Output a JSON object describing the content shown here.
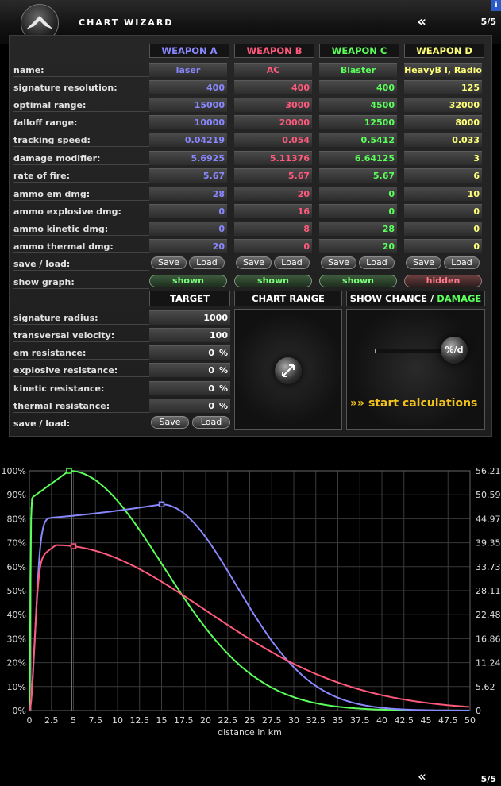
{
  "header": {
    "title": "CHART WIZARD",
    "back_glyph": "«",
    "page": "5/5",
    "corner_badge": "i"
  },
  "weapons": {
    "row_labels": [
      "name:",
      "signature resolution:",
      "optimal range:",
      "falloff range:",
      "tracking speed:",
      "damage modifier:",
      "rate of fire:",
      "ammo em dmg:",
      "ammo explosive dmg:",
      "ammo kinetic dmg:",
      "ammo thermal dmg:",
      "save / load:",
      "show graph:"
    ],
    "columns": [
      {
        "header": "WEAPON A",
        "color": "#8a88ff",
        "values": [
          "laser",
          "400",
          "15000",
          "10000",
          "0.04219",
          "5.6925",
          "5.67",
          "28",
          "0",
          "0",
          "20"
        ],
        "graph": "shown"
      },
      {
        "header": "WEAPON B",
        "color": "#ff5a7c",
        "values": [
          "AC",
          "400",
          "3000",
          "20000",
          "0.054",
          "5.11376",
          "5.67",
          "20",
          "16",
          "8",
          "0"
        ],
        "graph": "shown"
      },
      {
        "header": "WEAPON C",
        "color": "#5aff5a",
        "values": [
          "Blaster",
          "400",
          "4500",
          "12500",
          "0.5412",
          "6.64125",
          "5.67",
          "0",
          "0",
          "28",
          "20"
        ],
        "graph": "shown"
      },
      {
        "header": "WEAPON D",
        "color": "#ffff7a",
        "values": [
          "HeavyB I, Radio",
          "125",
          "32000",
          "8000",
          "0.033",
          "3",
          "6",
          "10",
          "0",
          "0",
          "0"
        ],
        "graph": "hidden"
      }
    ],
    "save_label": "Save",
    "load_label": "Load"
  },
  "target": {
    "headers": {
      "target": "TARGET",
      "chart_range": "CHART RANGE",
      "show_chance": "SHOW CHANCE /",
      "damage": "DAMAGE"
    },
    "row_labels": [
      "signature radius:",
      "transversal velocity:",
      "em resistance:",
      "explosive resistance:",
      "kinetic resistance:",
      "thermal resistance:",
      "save / load:"
    ],
    "values": [
      "1000",
      "100",
      "0",
      "0",
      "0",
      "0"
    ],
    "pct": "%",
    "save_label": "Save",
    "load_label": "Load",
    "toggle_glyph": "%/d",
    "start_label": "start calculations",
    "start_glyph": "»»"
  },
  "chart_data": {
    "type": "line",
    "xlabel": "distance in km",
    "xlim": [
      0,
      50
    ],
    "x_ticks": [
      "0",
      "2.5",
      "5",
      "7.5",
      "10",
      "12.5",
      "15",
      "17.5",
      "20",
      "22.5",
      "25",
      "27.5",
      "30",
      "32.5",
      "35",
      "37.5",
      "40",
      "42.5",
      "45",
      "47.5",
      "50"
    ],
    "y_left_ticks": [
      "0%",
      "10%",
      "20%",
      "30%",
      "40%",
      "50%",
      "60%",
      "70%",
      "80%",
      "90%",
      "100%"
    ],
    "y_right_ticks": [
      "0",
      "5.62",
      "11.24",
      "16.86",
      "22.48",
      "28.11",
      "33.73",
      "39.35",
      "44.97",
      "50.59",
      "56.21"
    ],
    "ylim": [
      0,
      100
    ],
    "grid": true,
    "series": [
      {
        "color": "#5aff5a",
        "optimal_km": 4.5,
        "falloff_km": 12.5,
        "peak": 100,
        "rise": 0.13,
        "marker_x": 4.5
      },
      {
        "color": "#8a88ff",
        "optimal_km": 15,
        "falloff_km": 10,
        "peak": 86,
        "rise": 0.9,
        "marker_x": 15
      },
      {
        "color": "#ff5a7c",
        "optimal_km": 3,
        "falloff_km": 20,
        "peak": 69,
        "rise": 0.75,
        "marker_x": 5
      }
    ],
    "vline_x": 4.8
  },
  "footer": {
    "back_glyph": "«",
    "page": "5/5"
  }
}
